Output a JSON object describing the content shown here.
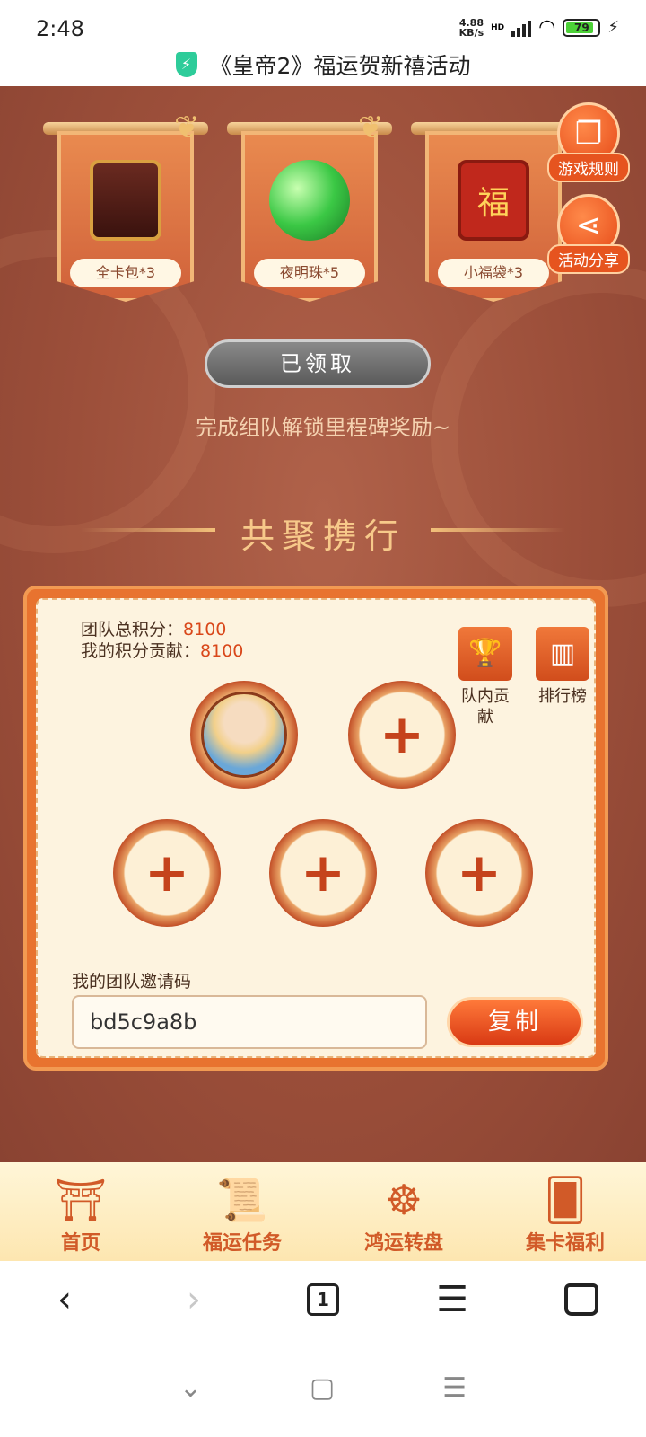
{
  "status_bar": {
    "time": "2:48",
    "net_speed_value": "4.88",
    "net_speed_unit": "KB/s",
    "hd": "HD",
    "battery": "79"
  },
  "header": {
    "title": "《皇帝2》福运贺新禧活动"
  },
  "rewards": [
    {
      "label": "全卡包*3",
      "icon": "card-pack-icon"
    },
    {
      "label": "夜明珠*5",
      "icon": "pearl-icon"
    },
    {
      "label": "小福袋*3",
      "icon": "lucky-bag-icon"
    }
  ],
  "side_buttons": {
    "rules": "游戏规则",
    "share": "活动分享"
  },
  "claim": {
    "button_label": "已领取",
    "milestone_text": "完成组队解锁里程碑奖励~"
  },
  "team": {
    "section_title": "共聚携行",
    "total_score_label": "团队总积分：",
    "total_score_value": "8100",
    "my_score_label": "我的积分贡献：",
    "my_score_value": "8100",
    "contribution_label": "队内贡献",
    "ranking_label": "排行榜",
    "invite_label": "我的团队邀请码",
    "invite_code": "bd5c9a8b",
    "copy_label": "复制"
  },
  "bottom_nav": [
    {
      "label": "首页",
      "icon": "pavilion-icon"
    },
    {
      "label": "福运任务",
      "icon": "scroll-icon"
    },
    {
      "label": "鸿运转盘",
      "icon": "wheel-icon"
    },
    {
      "label": "集卡福利",
      "icon": "cards-icon"
    }
  ],
  "browser": {
    "tab_count": "1"
  },
  "colors": {
    "primary": "#e6541f",
    "background": "#9c4f3a",
    "panel": "#fdf3df",
    "accent_text": "#d9471a"
  }
}
